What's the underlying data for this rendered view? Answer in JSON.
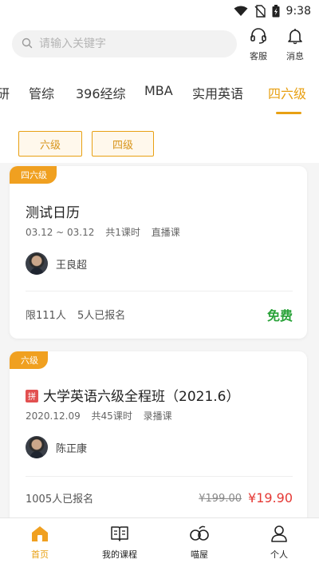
{
  "status_bar": {
    "time": "9:38"
  },
  "search": {
    "placeholder": "请输入关键字"
  },
  "header_actions": {
    "service": "客服",
    "messages": "消息"
  },
  "tabs": [
    {
      "label": "研"
    },
    {
      "label": "管综"
    },
    {
      "label": "396经综"
    },
    {
      "label": "MBA"
    },
    {
      "label": "实用英语"
    },
    {
      "label": "四六级",
      "active": true
    }
  ],
  "filters": [
    {
      "label": "六级"
    },
    {
      "label": "四级"
    }
  ],
  "courses": [
    {
      "badge": "四六级",
      "title": "测试日历",
      "date": "03.12 ~ 03.12",
      "lessons": "共1课时",
      "type": "直播课",
      "teacher": "王良超",
      "limit": "限111人",
      "enrolled": "5人已报名",
      "price": "免费"
    },
    {
      "badge": "六级",
      "group_tag": "拼",
      "title": "大学英语六级全程班（2021.6）",
      "date": "2020.12.09",
      "lessons": "共45课时",
      "type": "录播课",
      "teacher": "陈正康",
      "enrolled": "1005人已报名",
      "original_price": "¥199.00",
      "price": "¥19.90"
    }
  ],
  "bottom_nav": [
    {
      "label": "首页",
      "icon": "home-icon",
      "active": true
    },
    {
      "label": "我的课程",
      "icon": "book-icon"
    },
    {
      "label": "喵屋",
      "icon": "community-icon"
    },
    {
      "label": "个人",
      "icon": "person-icon"
    }
  ],
  "colors": {
    "accent": "#e8a013",
    "free_price": "#2aa33a",
    "sale_price": "#e53935",
    "group_tag": "#e25050"
  }
}
